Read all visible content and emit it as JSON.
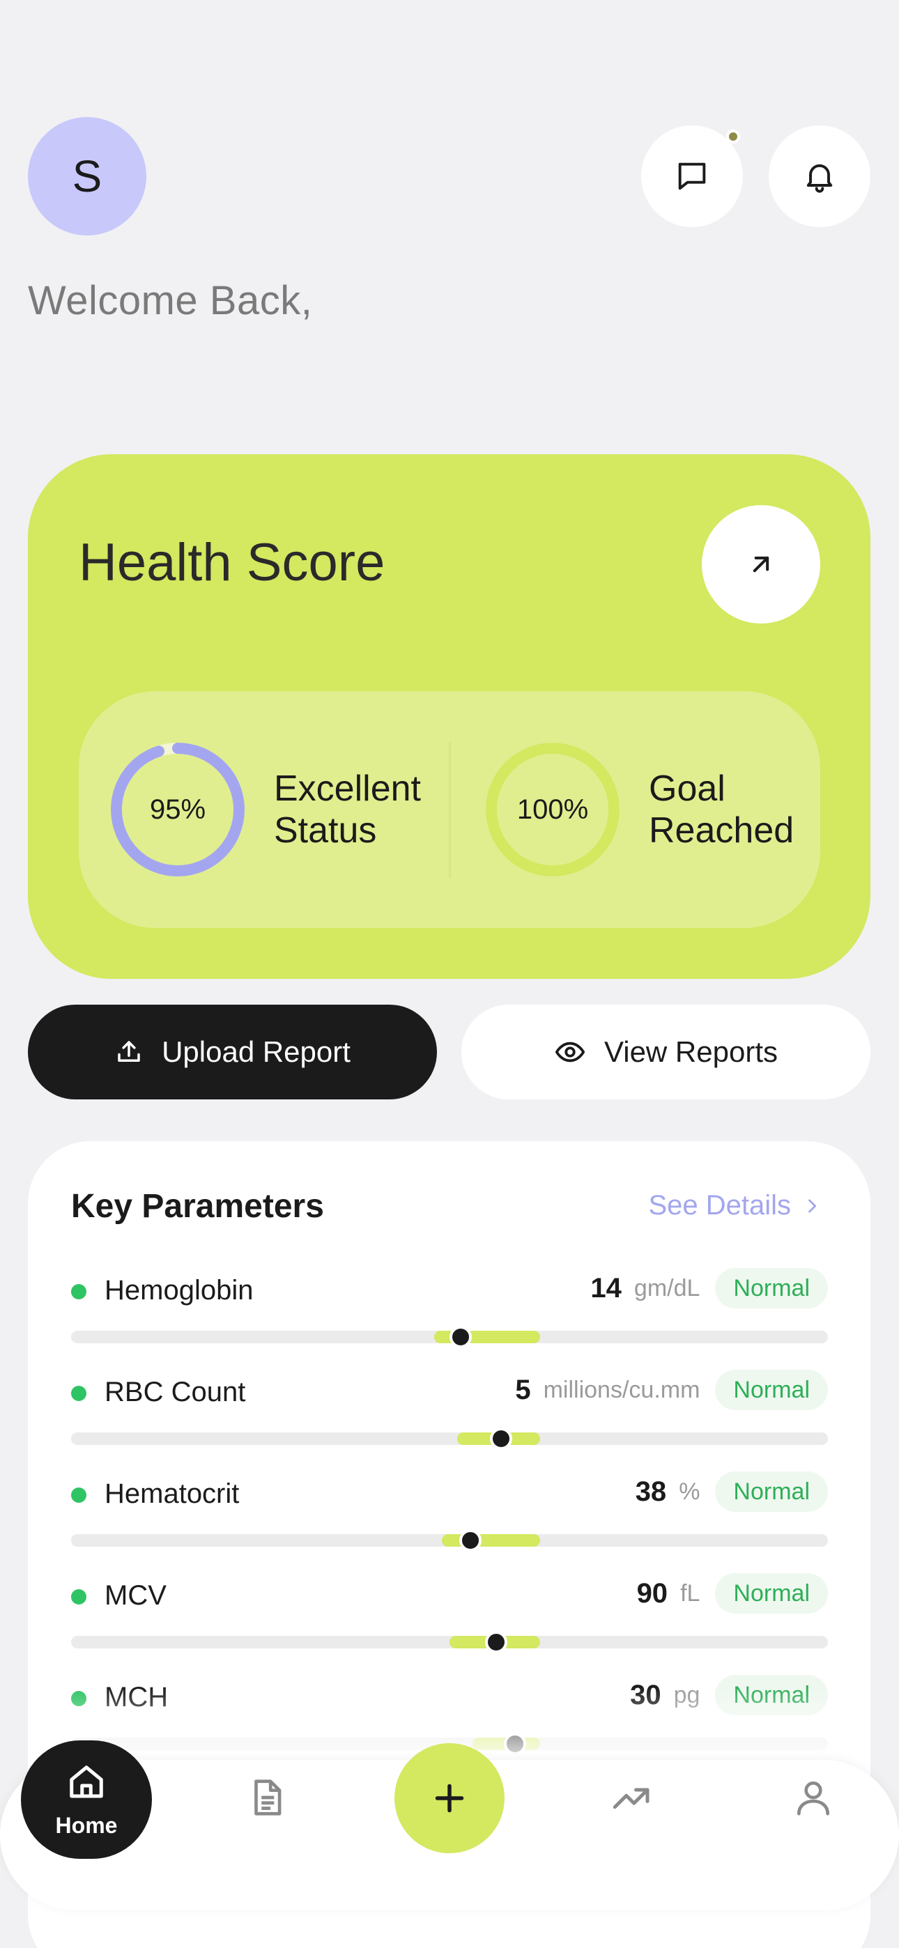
{
  "header": {
    "avatar_initial": "S",
    "welcome": "Welcome Back,"
  },
  "health_card": {
    "title": "Health Score",
    "stats": [
      {
        "value": "95%",
        "progress": 0.95,
        "label_line1": "Excellent",
        "label_line2": "Status",
        "color": "#a3a6ee"
      },
      {
        "value": "100%",
        "progress": 1.0,
        "label_line1": "Goal",
        "label_line2": "Reached",
        "color": "#d4e860"
      }
    ]
  },
  "actions": {
    "upload_label": "Upload Report",
    "view_label": "View Reports"
  },
  "key_parameters": {
    "title": "Key Parameters",
    "see_details": "See Details",
    "items": [
      {
        "name": "Hemoglobin",
        "value": "14",
        "unit": "gm/dL",
        "status": "Normal",
        "range_start": 0.48,
        "range_end": 0.62,
        "marker": 0.515
      },
      {
        "name": "RBC Count",
        "value": "5",
        "unit": "millions/cu.mm",
        "status": "Normal",
        "range_start": 0.51,
        "range_end": 0.62,
        "marker": 0.568
      },
      {
        "name": "Hematocrit",
        "value": "38",
        "unit": "%",
        "status": "Normal",
        "range_start": 0.49,
        "range_end": 0.62,
        "marker": 0.528
      },
      {
        "name": "MCV",
        "value": "90",
        "unit": "fL",
        "status": "Normal",
        "range_start": 0.5,
        "range_end": 0.62,
        "marker": 0.562
      },
      {
        "name": "MCH",
        "value": "30",
        "unit": "pg",
        "status": "Normal",
        "range_start": 0.53,
        "range_end": 0.62,
        "marker": 0.587
      }
    ]
  },
  "nav": {
    "home_label": "Home",
    "icons": [
      "home-icon",
      "document-icon",
      "plus-icon",
      "trend-icon",
      "profile-icon"
    ]
  },
  "colors": {
    "accent": "#d4e860",
    "lavender": "#a3a6ee",
    "status_green": "#2fc463",
    "dark": "#1b1b1b"
  }
}
